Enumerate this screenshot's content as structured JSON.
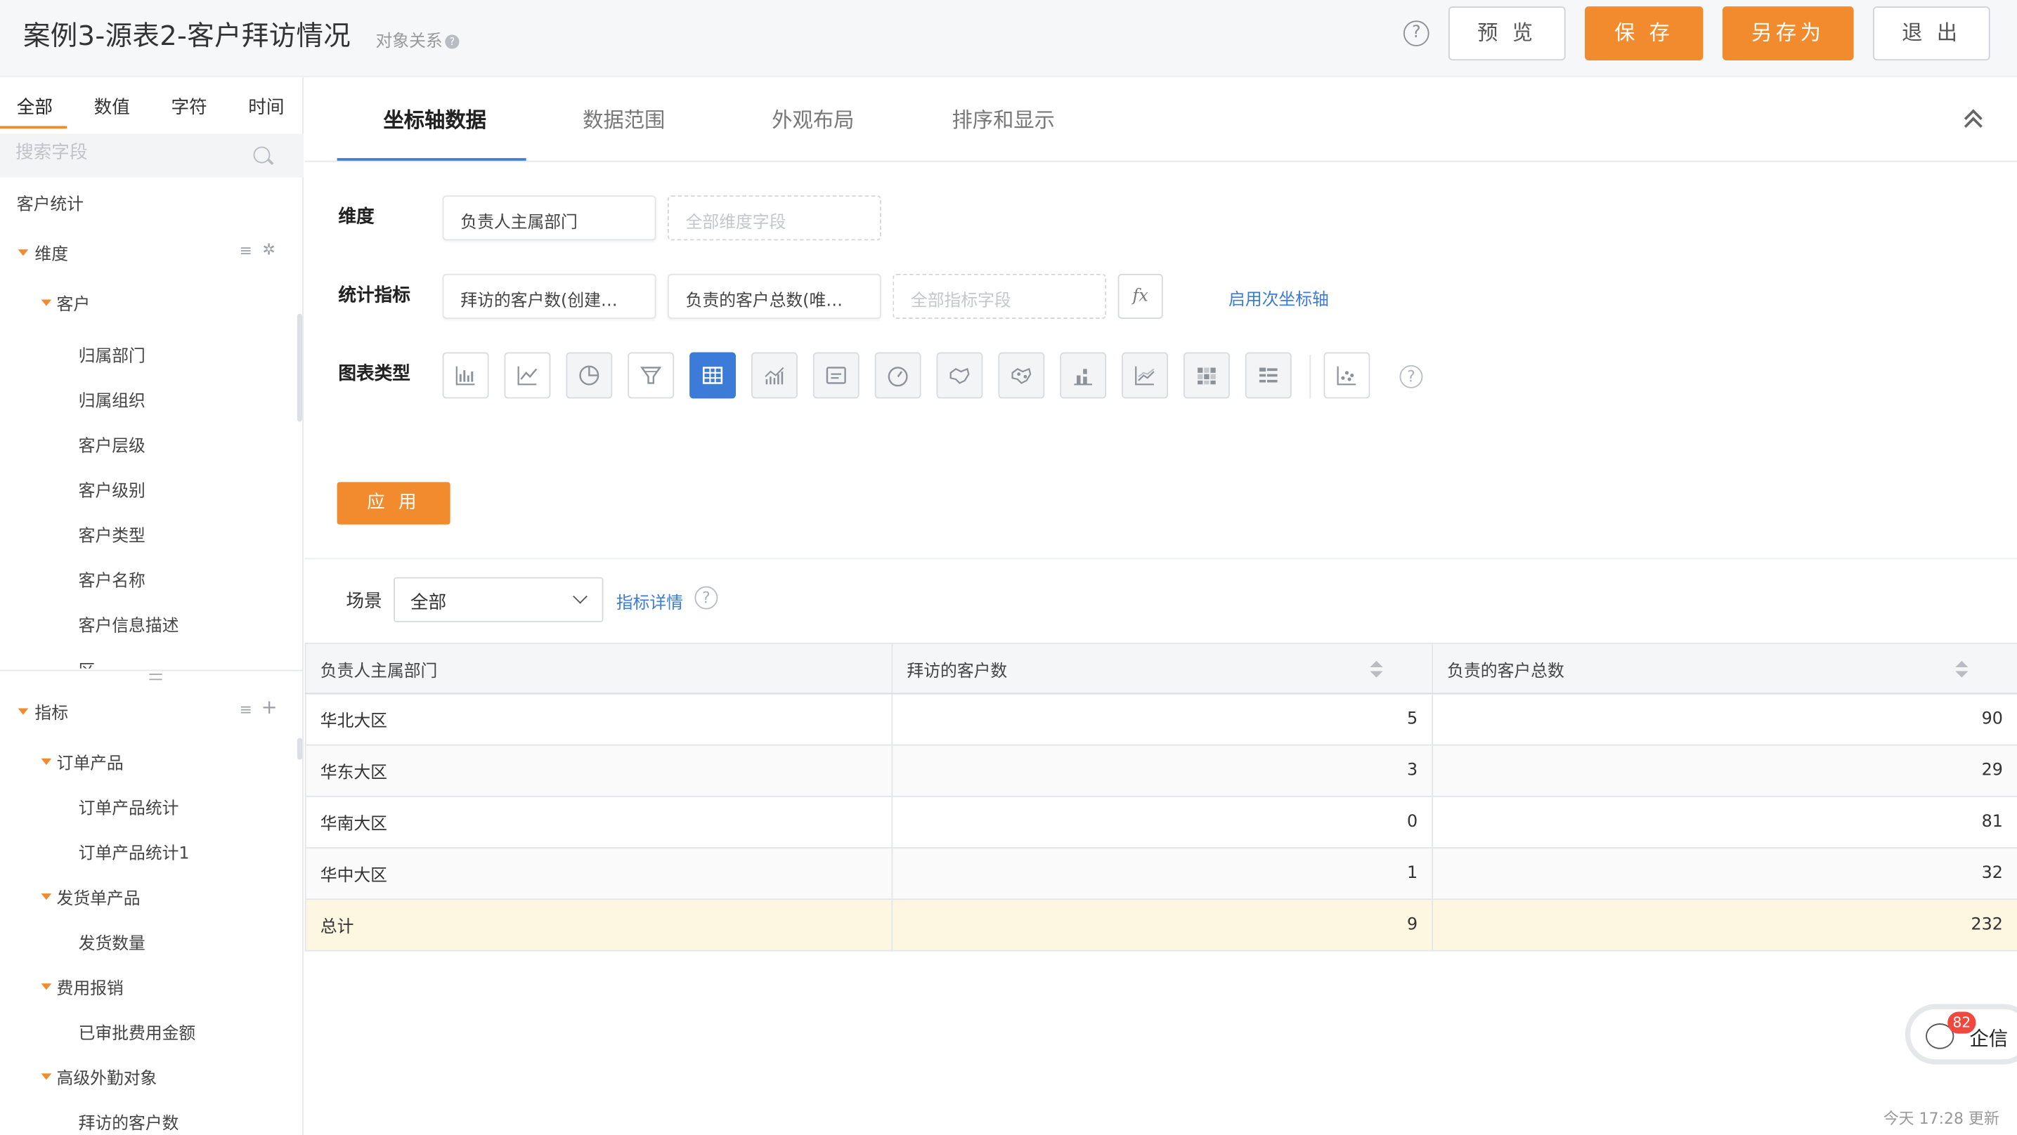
{
  "header": {
    "title": "案例3-源表2-客户拜访情况",
    "object_relation": "对象关系",
    "help_glyph": "?",
    "buttons": {
      "preview": "预 览",
      "save": "保 存",
      "save_as": "另存为",
      "exit": "退 出"
    }
  },
  "left": {
    "filter_tabs": [
      "全部",
      "数值",
      "字符",
      "时间"
    ],
    "active_filter": "全部",
    "search_placeholder": "搜索字段",
    "tree": {
      "root": "客户统计",
      "dimension_label": "维度",
      "dimension_group": "客户",
      "dimension_fields": [
        "归属部门",
        "归属组织",
        "客户层级",
        "客户级别",
        "客户类型",
        "客户名称",
        "客户信息描述",
        "区"
      ],
      "metric_label": "指标",
      "metric_groups": [
        {
          "name": "订单产品",
          "fields": [
            "订单产品统计",
            "订单产品统计1"
          ]
        },
        {
          "name": "发货单产品",
          "fields": [
            "发货数量"
          ]
        },
        {
          "name": "费用报销",
          "fields": [
            "已审批费用金额"
          ]
        },
        {
          "name": "高级外勤对象",
          "fields": [
            "拜访的客户数"
          ]
        }
      ]
    }
  },
  "main": {
    "tabs": [
      "坐标轴数据",
      "数据范围",
      "外观布局",
      "排序和显示"
    ],
    "active_tab": "坐标轴数据",
    "form": {
      "dimension_label": "维度",
      "dimension_value": "负责人主属部门",
      "dimension_placeholder": "全部维度字段",
      "metric_label": "统计指标",
      "metric_values": [
        "拜访的客户数(创建…",
        "负责的客户总数(唯…"
      ],
      "metric_placeholder": "全部指标字段",
      "fx_label": "fx",
      "secondary_axis_link": "启用次坐标轴",
      "chart_type_label": "图表类型",
      "chart_types": [
        "bar-chart-icon",
        "line-chart-icon",
        "pie-chart-icon",
        "funnel-chart-icon",
        "table-chart-icon",
        "bar-line-combo-icon",
        "card-icon",
        "gauge-icon",
        "map-icon",
        "map-dots-icon",
        "stacked-bar-icon",
        "area-line-icon",
        "heatmap-icon",
        "pivot-table-icon",
        "scatter-icon"
      ],
      "active_chart_type": "table-chart-icon",
      "apply": "应 用"
    },
    "scene": {
      "label": "场景",
      "value": "全部",
      "metric_detail_link": "指标详情"
    },
    "table": {
      "headers": [
        "负责人主属部门",
        "拜访的客户数",
        "负责的客户总数"
      ],
      "rows": [
        [
          "华北大区",
          "5",
          "90"
        ],
        [
          "华东大区",
          "3",
          "29"
        ],
        [
          "华南大区",
          "0",
          "81"
        ],
        [
          "华中大区",
          "1",
          "32"
        ]
      ],
      "total": [
        "总计",
        "9",
        "232"
      ]
    },
    "qixin": {
      "label": "企信",
      "badge": "82"
    },
    "update_time": "今天 17:28 更新"
  },
  "colors": {
    "accent_orange": "#f28b2d",
    "accent_blue": "#3d7bd8",
    "total_row": "#fdf6e1",
    "badge_red": "#f0483e"
  }
}
